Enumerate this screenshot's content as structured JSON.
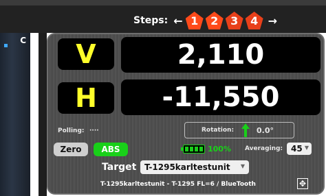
{
  "steps": {
    "label": "Steps:",
    "left_arrow": "←",
    "right_arrow": "→",
    "items": [
      "1",
      "2",
      "3",
      "4"
    ]
  },
  "left_panel": {
    "label": "C"
  },
  "readouts": {
    "v": {
      "letter": "V",
      "value": "2,110"
    },
    "h": {
      "letter": "H",
      "value": "-11,550"
    }
  },
  "polling": {
    "label": "Polling:",
    "value": "····"
  },
  "rotation": {
    "label": "Rotation:",
    "value": "0.0°"
  },
  "buttons": {
    "zero": "Zero",
    "abs": "ABS"
  },
  "battery": {
    "percent": "100%",
    "level": 1.0
  },
  "averaging": {
    "label": "Averaging:",
    "value": "45"
  },
  "target": {
    "label": "Target",
    "value": "T-1295karltestunit"
  },
  "footer": {
    "text": "T-1295karltestunit - T-1295 FL=6 / BlueTooth"
  },
  "colors": {
    "accent_orange": "#ff4a1a",
    "green": "#19d019",
    "yellow": "#ffff2a"
  },
  "icons": {
    "rotation": "up-arrow-icon",
    "expand": "expand-icon",
    "battery": "battery-icon"
  }
}
